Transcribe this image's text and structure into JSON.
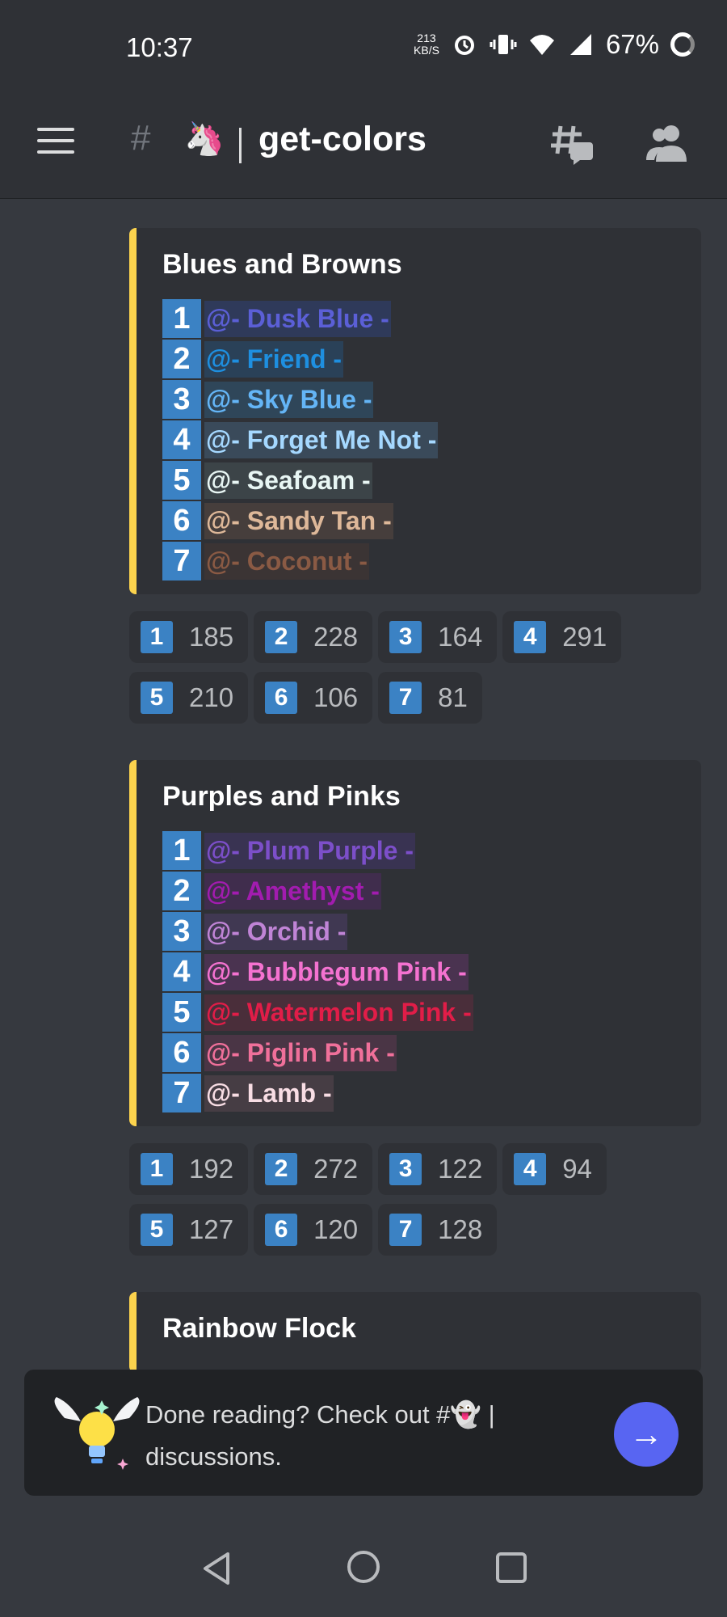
{
  "status_bar": {
    "time": "10:37",
    "net_speed_value": "213",
    "net_speed_unit": "KB/S",
    "battery": "67%"
  },
  "header": {
    "channel_emoji": "🦄",
    "channel_name": "get-colors"
  },
  "embeds": [
    {
      "title": "Blues and Browns",
      "roles": [
        {
          "num": "1",
          "label": "@- Dusk Blue -",
          "color": "#5b5fd6",
          "bg": "#2f3a5a"
        },
        {
          "num": "2",
          "label": "@- Friend -",
          "color": "#1e8fe0",
          "bg": "#2a4158"
        },
        {
          "num": "3",
          "label": "@- Sky Blue -",
          "color": "#64b5f6",
          "bg": "#2f4659"
        },
        {
          "num": "4",
          "label": "@- Forget Me Not -",
          "color": "#a5d8ff",
          "bg": "#3a4a5a"
        },
        {
          "num": "5",
          "label": "@- Seafoam -",
          "color": "#e8f6f4",
          "bg": "#3c4448"
        },
        {
          "num": "6",
          "label": "@- Sandy Tan -",
          "color": "#deb899",
          "bg": "#463e3c"
        },
        {
          "num": "7",
          "label": "@- Coconut -",
          "color": "#8a5a44",
          "bg": "#3b3434"
        }
      ],
      "reactions": [
        {
          "num": "1",
          "count": "185"
        },
        {
          "num": "2",
          "count": "228"
        },
        {
          "num": "3",
          "count": "164"
        },
        {
          "num": "4",
          "count": "291"
        },
        {
          "num": "5",
          "count": "210"
        },
        {
          "num": "6",
          "count": "106"
        },
        {
          "num": "7",
          "count": "81"
        }
      ]
    },
    {
      "title": "Purples and Pinks",
      "roles": [
        {
          "num": "1",
          "label": "@- Plum Purple -",
          "color": "#7c4fc9",
          "bg": "#393352"
        },
        {
          "num": "2",
          "label": "@- Amethyst -",
          "color": "#a21caf",
          "bg": "#402d4d"
        },
        {
          "num": "3",
          "label": "@- Orchid -",
          "color": "#c084d6",
          "bg": "#403852"
        },
        {
          "num": "4",
          "label": "@- Bubblegum Pink -",
          "color": "#f472d0",
          "bg": "#4a3350"
        },
        {
          "num": "5",
          "label": "@- Watermelon Pink -",
          "color": "#e11d48",
          "bg": "#4a2e3a"
        },
        {
          "num": "6",
          "label": "@- Piglin Pink -",
          "color": "#f0709a",
          "bg": "#4a3545"
        },
        {
          "num": "7",
          "label": "@- Lamb -",
          "color": "#f8dde4",
          "bg": "#463d44"
        }
      ],
      "reactions": [
        {
          "num": "1",
          "count": "192"
        },
        {
          "num": "2",
          "count": "272"
        },
        {
          "num": "3",
          "count": "122"
        },
        {
          "num": "4",
          "count": "94"
        },
        {
          "num": "5",
          "count": "127"
        },
        {
          "num": "6",
          "count": "120"
        },
        {
          "num": "7",
          "count": "128"
        }
      ]
    },
    {
      "title": "Rainbow Flock"
    }
  ],
  "prompt": {
    "text": "Done reading? Check out #👻 | discussions."
  },
  "colors": {
    "accent": "#fcd34d",
    "keycap": "#3b82c4",
    "button": "#5865f2"
  }
}
